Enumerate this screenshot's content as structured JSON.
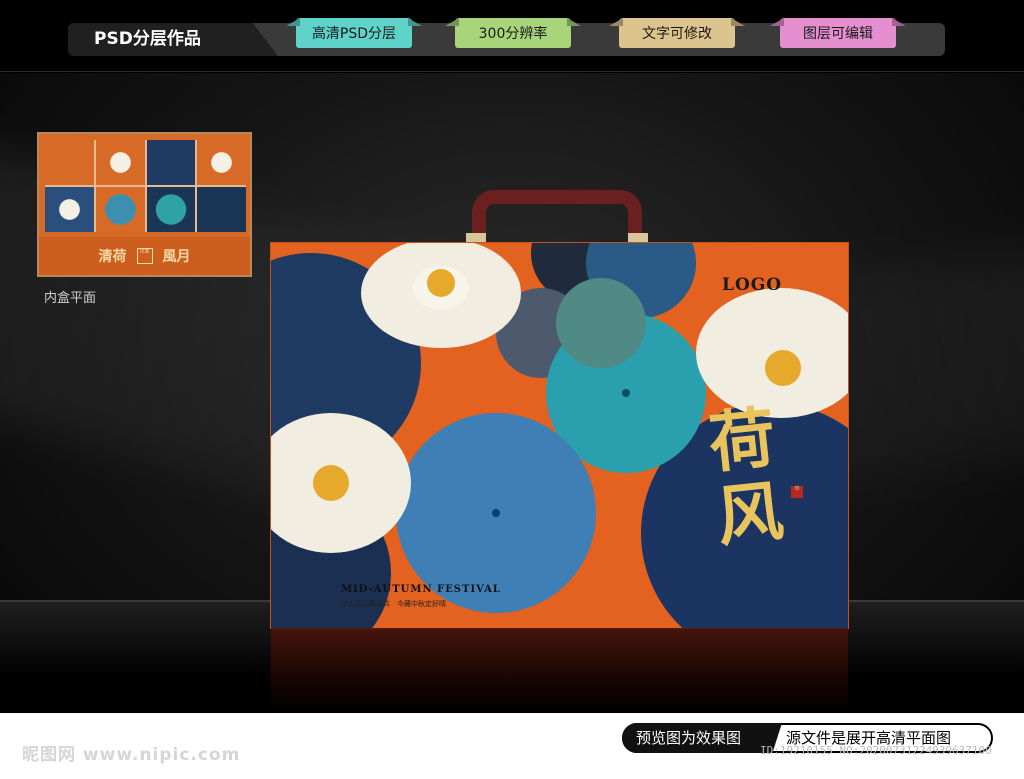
{
  "header": {
    "title": "PSD分层作品",
    "tags": [
      {
        "label": "高清PSD分层",
        "color": "#5fd3c9"
      },
      {
        "label": "300分辨率",
        "color": "#a8d57a"
      },
      {
        "label": "文字可修改",
        "color": "#dcc48e"
      },
      {
        "label": "图层可编辑",
        "color": "#e58fd0"
      }
    ]
  },
  "thumbnail": {
    "left_text": "清荷",
    "seal_text": "印章",
    "right_text": "風月",
    "caption": "内盒平面"
  },
  "giftbox": {
    "logo": "LOGO",
    "festival": "MID-AUTUMN FESTIVAL",
    "subtitle": "故人明月能家共　今藏中秋定好晴",
    "calligraphy": "荷风",
    "seal": "印",
    "box_color": "#e3621f",
    "handle_color": "#6b1f1f"
  },
  "footer": {
    "watermark": "昵图网 www.nipic.com",
    "preview_label": "预览图为效果图",
    "source_label": "源文件是展开高清平面图",
    "id_text": "ID:19210155 NO:20200731224939637100"
  }
}
